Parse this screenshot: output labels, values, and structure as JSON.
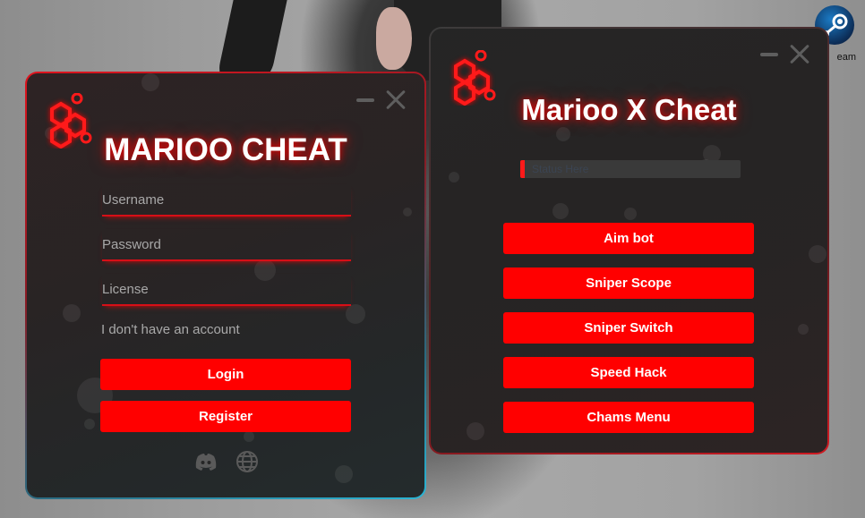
{
  "desktop": {
    "steam_label": "eam",
    "icon": "steam-icon"
  },
  "login_window": {
    "title": "MARIOO CHEAT",
    "username_placeholder": "Username",
    "password_placeholder": "Password",
    "license_placeholder": "License",
    "no_account_link": "I don't have an account",
    "login_button": "Login",
    "register_button": "Register",
    "icons": [
      "hexagon-logo-icon",
      "discord-icon",
      "globe-icon"
    ],
    "accent_color": "#ff0000",
    "border_gradient": [
      "#e0141e",
      "#2ab6d6"
    ]
  },
  "cheat_window": {
    "title": "Marioo X Cheat",
    "status_text": "Status Here",
    "buttons": [
      {
        "label": "Aim bot"
      },
      {
        "label": "Sniper Scope"
      },
      {
        "label": "Sniper Switch"
      },
      {
        "label": "Speed Hack"
      },
      {
        "label": "Chams Menu"
      }
    ],
    "accent_color": "#ff0000"
  }
}
